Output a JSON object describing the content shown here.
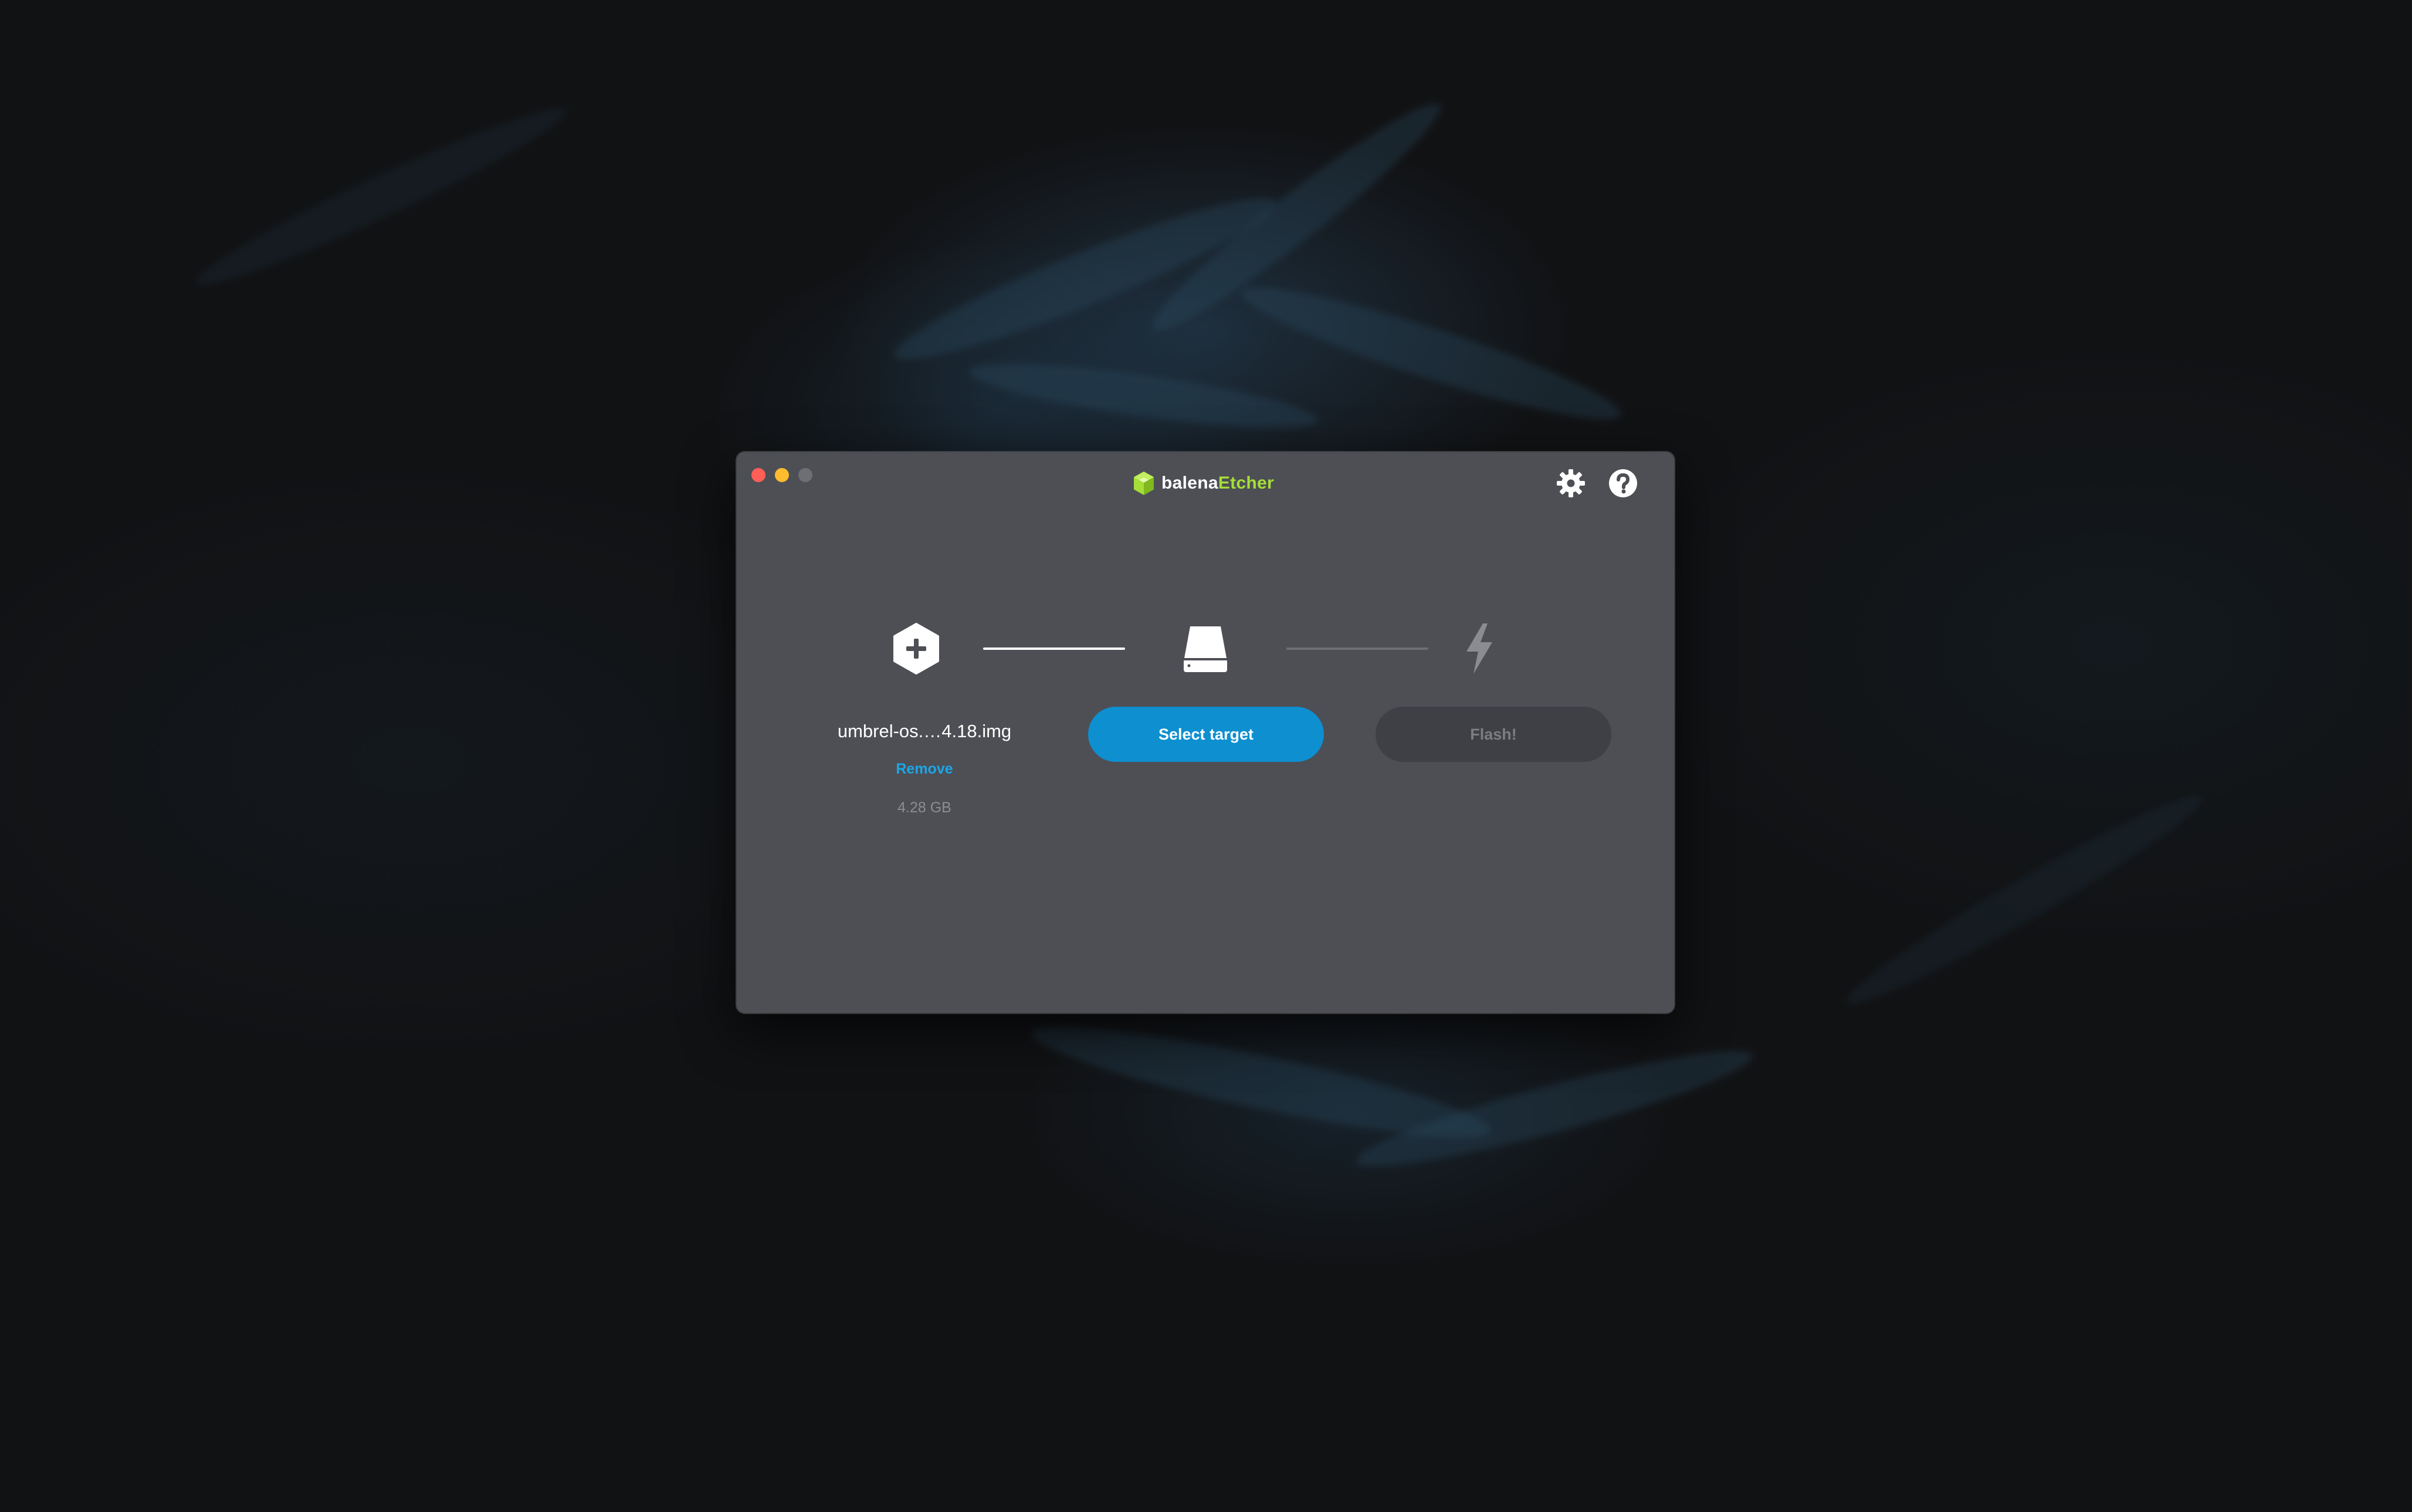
{
  "app": {
    "brand_prefix": "balena",
    "brand_suffix": "Etcher"
  },
  "colors": {
    "accent": "#0d8fd0",
    "brand_green": "#a5de37",
    "window_bg": "#4d4f55",
    "link": "#1ca6e6"
  },
  "header": {
    "settings_icon": "gear-icon",
    "help_icon": "question-mark-icon"
  },
  "steps": {
    "source": {
      "icon": "plus-hexagon-icon",
      "file_name": "umbrel-os.…4.18.img",
      "remove_label": "Remove",
      "size": "4.28 GB"
    },
    "target": {
      "icon": "drive-icon",
      "button_label": "Select target"
    },
    "flash": {
      "icon": "lightning-bolt-icon",
      "button_label": "Flash!"
    }
  }
}
